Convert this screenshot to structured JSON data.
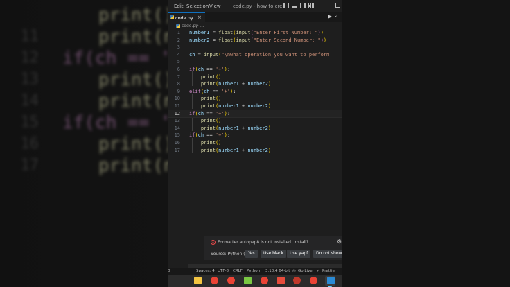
{
  "background_code": {
    "lines": [
      {
        "num": "",
        "text": "print()"
      },
      {
        "num": "11",
        "text": "print(nu"
      },
      {
        "num": "12",
        "text": "if(ch == '+'"
      },
      {
        "num": "13",
        "text": "print()"
      },
      {
        "num": "14",
        "text": "print(nu"
      },
      {
        "num": "15",
        "text": "if(ch == '+'"
      },
      {
        "num": "16",
        "text": "print()"
      },
      {
        "num": "17",
        "text": "print(nu"
      }
    ]
  },
  "titlebar": {
    "menus": [
      "Edit",
      "Selection",
      "View",
      "···"
    ],
    "title": "code.py - how to create s..."
  },
  "tab": {
    "label": "code.py",
    "close": "×"
  },
  "breadcrumb": {
    "file": "code.py",
    "rest": "> ..."
  },
  "editor": {
    "active_line": "12",
    "lines": [
      {
        "num": "1",
        "tokens": [
          [
            "id",
            "number1"
          ],
          [
            "op",
            " = "
          ],
          [
            "fn",
            "float"
          ],
          [
            "br",
            "("
          ],
          [
            "fn",
            "input"
          ],
          [
            "br2",
            "("
          ],
          [
            "str",
            "\"Enter First Number: \""
          ],
          [
            "br2",
            ")"
          ],
          [
            "br",
            ")"
          ]
        ]
      },
      {
        "num": "2",
        "tokens": [
          [
            "id",
            "number2"
          ],
          [
            "op",
            " = "
          ],
          [
            "fn",
            "float"
          ],
          [
            "br",
            "("
          ],
          [
            "fn",
            "input"
          ],
          [
            "br2",
            "("
          ],
          [
            "str",
            "\"Enter Second Number: \""
          ],
          [
            "br2",
            ")"
          ],
          [
            "br",
            ")"
          ]
        ]
      },
      {
        "num": "3",
        "tokens": []
      },
      {
        "num": "4",
        "tokens": [
          [
            "id",
            "ch"
          ],
          [
            "op",
            " = "
          ],
          [
            "fn",
            "input"
          ],
          [
            "br",
            "("
          ],
          [
            "str",
            "\"\\nwhat operation you want to perform."
          ]
        ]
      },
      {
        "num": "5",
        "tokens": []
      },
      {
        "num": "6",
        "tokens": [
          [
            "kw",
            "if"
          ],
          [
            "br",
            "("
          ],
          [
            "id",
            "ch"
          ],
          [
            "op",
            " == "
          ],
          [
            "str",
            "'+'"
          ],
          [
            "br",
            ")"
          ],
          [
            "op",
            ":"
          ]
        ]
      },
      {
        "num": "7",
        "tokens": [
          [
            "op",
            "    "
          ],
          [
            "fn",
            "print"
          ],
          [
            "br",
            "()"
          ]
        ]
      },
      {
        "num": "8",
        "tokens": [
          [
            "op",
            "    "
          ],
          [
            "fn",
            "print"
          ],
          [
            "br",
            "("
          ],
          [
            "id",
            "number1"
          ],
          [
            "op",
            " + "
          ],
          [
            "id",
            "number2"
          ],
          [
            "br",
            ")"
          ]
        ]
      },
      {
        "num": "9",
        "tokens": [
          [
            "kw",
            "elif"
          ],
          [
            "br",
            "("
          ],
          [
            "id",
            "ch"
          ],
          [
            "op",
            " == "
          ],
          [
            "str",
            "'+'"
          ],
          [
            "br",
            ")"
          ],
          [
            "op",
            ":"
          ]
        ]
      },
      {
        "num": "10",
        "tokens": [
          [
            "op",
            "    "
          ],
          [
            "fn",
            "print"
          ],
          [
            "br",
            "()"
          ]
        ]
      },
      {
        "num": "11",
        "tokens": [
          [
            "op",
            "    "
          ],
          [
            "fn",
            "print"
          ],
          [
            "br",
            "("
          ],
          [
            "id",
            "number1"
          ],
          [
            "op",
            " + "
          ],
          [
            "id",
            "number2"
          ],
          [
            "br",
            ")"
          ]
        ]
      },
      {
        "num": "12",
        "tokens": [
          [
            "kw",
            "if"
          ],
          [
            "br",
            "("
          ],
          [
            "id",
            "ch"
          ],
          [
            "op",
            " == "
          ],
          [
            "str",
            "'+'"
          ],
          [
            "br",
            ")"
          ],
          [
            "op",
            ":"
          ]
        ]
      },
      {
        "num": "13",
        "tokens": [
          [
            "op",
            "    "
          ],
          [
            "fn",
            "print"
          ],
          [
            "br",
            "()"
          ]
        ]
      },
      {
        "num": "14",
        "tokens": [
          [
            "op",
            "    "
          ],
          [
            "fn",
            "print"
          ],
          [
            "br",
            "("
          ],
          [
            "id",
            "number1"
          ],
          [
            "op",
            " + "
          ],
          [
            "id",
            "number2"
          ],
          [
            "br",
            ")"
          ]
        ]
      },
      {
        "num": "15",
        "tokens": [
          [
            "kw",
            "if"
          ],
          [
            "br",
            "("
          ],
          [
            "id",
            "ch"
          ],
          [
            "op",
            " == "
          ],
          [
            "str",
            "'+'"
          ],
          [
            "br",
            ")"
          ],
          [
            "op",
            ":"
          ]
        ]
      },
      {
        "num": "16",
        "tokens": [
          [
            "op",
            "    "
          ],
          [
            "fn",
            "print"
          ],
          [
            "br",
            "()"
          ]
        ]
      },
      {
        "num": "17",
        "tokens": [
          [
            "op",
            "    "
          ],
          [
            "fn",
            "print"
          ],
          [
            "br",
            "("
          ],
          [
            "id",
            "number1"
          ],
          [
            "op",
            " + "
          ],
          [
            "id",
            "number2"
          ],
          [
            "br",
            ")"
          ]
        ]
      }
    ]
  },
  "notification": {
    "message": "Formatter autopep8 is not installed. Install?",
    "source": "Source: Python (E...",
    "buttons": [
      "Yes",
      "Use black",
      "Use yapf",
      "Do not show a"
    ]
  },
  "statusbar": {
    "left": "0",
    "spaces": "Spaces: 4",
    "encoding": "UTF-8",
    "eol": "CRLF",
    "language": "Python",
    "interpreter": "3.10.4 64-bit",
    "golive": "Go Live",
    "prettier": "Prettier"
  },
  "taskbar": {
    "apps": [
      "file-explorer-icon",
      "chrome-icon",
      "chrome-icon",
      "notepad-plus-icon",
      "chrome-icon",
      "app-red-icon",
      "record-icon",
      "chrome-icon",
      "vscode-icon"
    ]
  },
  "colors": {
    "editor_bg": "#1e1e1e",
    "keyword": "#c586c0",
    "function": "#dcdcaa",
    "identifier": "#9cdcfe",
    "string": "#ce9178",
    "bracket": "#ffd700",
    "error": "#f14c4c",
    "accent": "#0e70c0"
  }
}
